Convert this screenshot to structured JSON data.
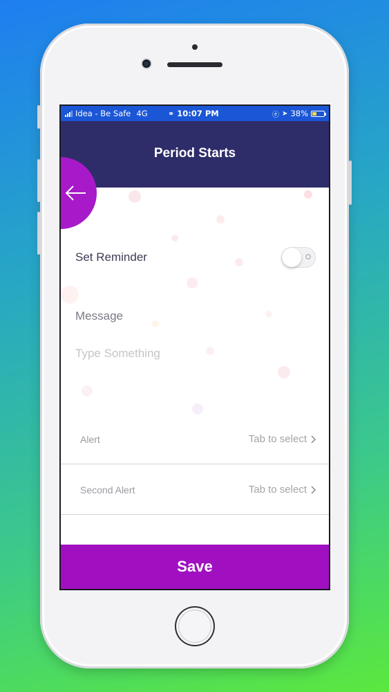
{
  "status_bar": {
    "carrier": "Idea - Be Safe",
    "network": "4G",
    "time": "10:07 PM",
    "battery": "38%",
    "battery_level": 0.38
  },
  "header": {
    "title": "Period Starts",
    "back_icon": "arrow-left-icon"
  },
  "reminder": {
    "label": "Set Reminder",
    "enabled": false
  },
  "message": {
    "label": "Message",
    "placeholder": "Type Something",
    "value": ""
  },
  "alerts": [
    {
      "label": "Alert",
      "value": "Tab to select",
      "icon": "chevron-right-icon"
    },
    {
      "label": "Second Alert",
      "value": "Tab to select",
      "icon": "chevron-right-icon"
    }
  ],
  "save": {
    "label": "Save"
  },
  "colors": {
    "header": "#2f2c6a",
    "accent": "#a010c0",
    "back_button": "#a719c9",
    "status_bar": "#1a56d6"
  }
}
